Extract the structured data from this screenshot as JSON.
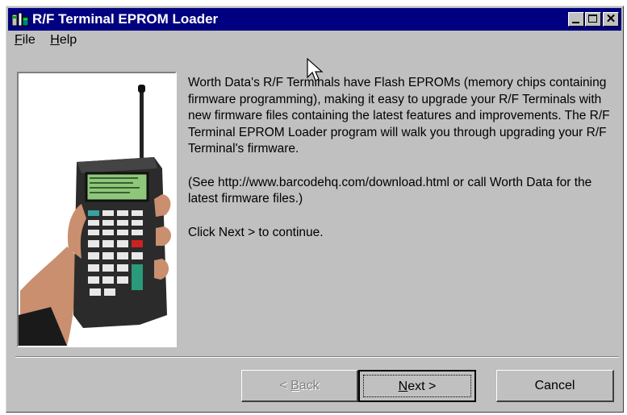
{
  "window": {
    "title": "R/F Terminal EPROM Loader",
    "icon": "app-icon"
  },
  "menu": {
    "items": [
      {
        "label": "File",
        "accel": "F",
        "rest": "ile"
      },
      {
        "label": "Help",
        "accel": "H",
        "rest": "elp"
      }
    ]
  },
  "content": {
    "paragraph1": "Worth Data's R/F Terminals have Flash EPROMs (memory chips containing firmware programming), making it easy to upgrade your R/F Terminals with new firmware files containing the latest features and improvements. The R/F Terminal EPROM Loader program will walk you through upgrading your R/F Terminal's firmware.",
    "paragraph2": "(See http://www.barcodehq.com/download.html or call Worth Data for the latest firmware files.)",
    "paragraph3_prefix": "Click ",
    "paragraph3_link": "Next >",
    "paragraph3_suffix": " to continue."
  },
  "buttons": {
    "back_prefix": "< ",
    "back_accel": "B",
    "back_rest": "ack",
    "next_accel": "N",
    "next_rest": "ext >",
    "cancel": "Cancel"
  },
  "colors": {
    "titlebar": "#000080",
    "window": "#c0c0c0",
    "screen": "#8fc77a"
  }
}
